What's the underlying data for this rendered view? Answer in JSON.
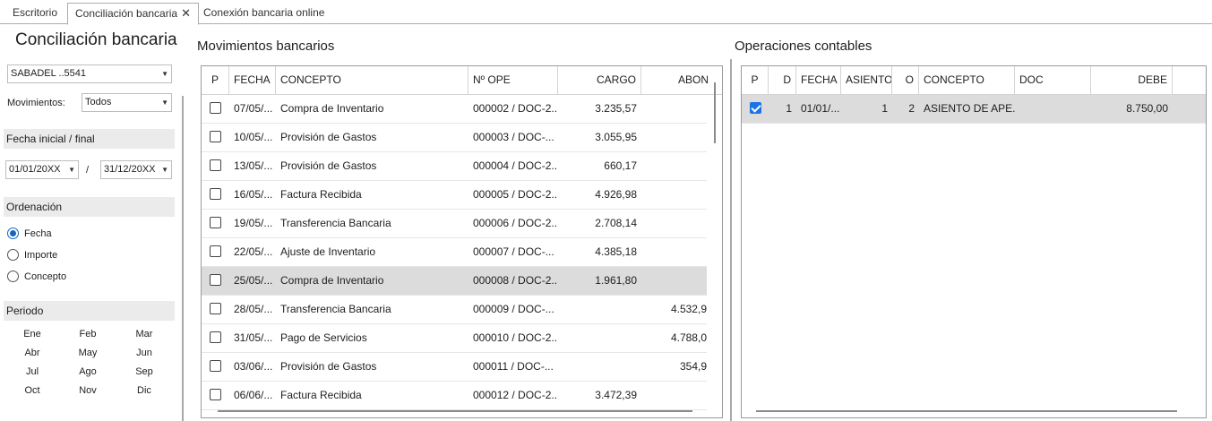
{
  "tabs": [
    {
      "label": "Escritorio"
    },
    {
      "label": "Conciliación bancaria",
      "close": "✕"
    },
    {
      "label": "Conexión bancaria online"
    }
  ],
  "sidebar": {
    "title": "Conciliación bancaria",
    "account": "SABADEL ..5541",
    "movements_label": "Movimientos:",
    "movements_value": "Todos",
    "date_section": "Fecha inicial / final",
    "date_start": "01/01/20XX",
    "date_sep": "/",
    "date_end": "31/12/20XX",
    "order_section": "Ordenación",
    "order_options": [
      "Fecha",
      "Importe",
      "Concepto"
    ],
    "period_section": "Periodo",
    "months": [
      "Ene",
      "Feb",
      "Mar",
      "Abr",
      "May",
      "Jun",
      "Jul",
      "Ago",
      "Sep",
      "Oct",
      "Nov",
      "Dic"
    ]
  },
  "bank": {
    "heading": "Movimientos bancarios",
    "columns": [
      "P",
      "FECHA",
      "CONCEPTO",
      "Nº OPE",
      "CARGO",
      "ABON"
    ],
    "rows": [
      {
        "fecha": "07/05/...",
        "concepto": "Compra de Inventario",
        "ope": "000002 / DOC-2...",
        "cargo": "3.235,57",
        "abono": ""
      },
      {
        "fecha": "10/05/...",
        "concepto": "Provisión de Gastos",
        "ope": "000003 / DOC-...",
        "cargo": "3.055,95",
        "abono": ""
      },
      {
        "fecha": "13/05/...",
        "concepto": "Provisión de Gastos",
        "ope": "000004 / DOC-2...",
        "cargo": "660,17",
        "abono": ""
      },
      {
        "fecha": "16/05/...",
        "concepto": "Factura Recibida",
        "ope": "000005 / DOC-2...",
        "cargo": "4.926,98",
        "abono": ""
      },
      {
        "fecha": "19/05/...",
        "concepto": "Transferencia Bancaria",
        "ope": "000006 / DOC-2...",
        "cargo": "2.708,14",
        "abono": ""
      },
      {
        "fecha": "22/05/...",
        "concepto": "Ajuste de Inventario",
        "ope": "000007 / DOC-...",
        "cargo": "4.385,18",
        "abono": ""
      },
      {
        "fecha": "25/05/...",
        "concepto": "Compra de Inventario",
        "ope": "000008 / DOC-2...",
        "cargo": "1.961,80",
        "abono": "",
        "selected": true
      },
      {
        "fecha": "28/05/...",
        "concepto": "Transferencia Bancaria",
        "ope": "000009 / DOC-...",
        "cargo": "",
        "abono": "4.532,9"
      },
      {
        "fecha": "31/05/...",
        "concepto": "Pago de Servicios",
        "ope": "000010 / DOC-2...",
        "cargo": "",
        "abono": "4.788,0"
      },
      {
        "fecha": "03/06/...",
        "concepto": "Provisión de Gastos",
        "ope": "000011 / DOC-...",
        "cargo": "",
        "abono": "354,9"
      },
      {
        "fecha": "06/06/...",
        "concepto": "Factura Recibida",
        "ope": "000012 / DOC-2...",
        "cargo": "3.472,39",
        "abono": ""
      }
    ]
  },
  "accounting": {
    "heading": "Operaciones contables",
    "columns": [
      "P",
      "D",
      "FECHA",
      "ASIENTO",
      "O",
      "CONCEPTO",
      "DOC",
      "DEBE"
    ],
    "rows": [
      {
        "d": "1",
        "fecha": "01/01/...",
        "asiento": "1",
        "o": "2",
        "concepto": "ASIENTO DE APE...",
        "doc": "",
        "debe": "8.750,00",
        "checked": true
      }
    ]
  }
}
